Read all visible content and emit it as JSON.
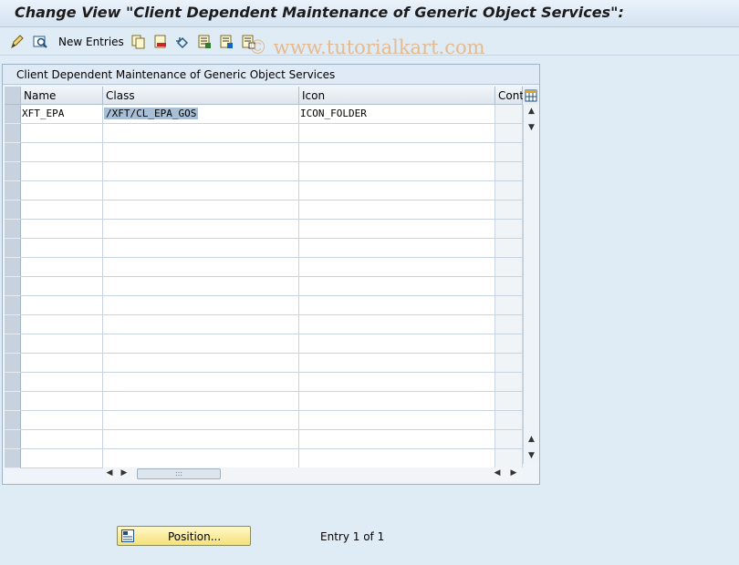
{
  "title": "Change View \"Client Dependent Maintenance of Generic Object Services\":",
  "toolbar": {
    "new_entries": "New Entries",
    "watermark": "© www.tutorialkart.com",
    "icons": [
      "display-change-icon",
      "details-icon",
      "new-entries",
      "copy-icon",
      "delete-icon",
      "undo-icon",
      "select-all-icon",
      "select-block-icon",
      "deselect-all-icon"
    ]
  },
  "panel": {
    "title": "Client Dependent Maintenance of Generic Object Services"
  },
  "table": {
    "columns": [
      "Name",
      "Class",
      "Icon",
      "Conti"
    ],
    "rows": [
      [
        "XFT_EPA",
        "/XFT/CL_EPA_GOS",
        "ICON_FOLDER",
        ""
      ]
    ],
    "empty_row_count": 18
  },
  "footer": {
    "position_label": "Position...",
    "entry_text": "Entry 1 of 1"
  },
  "colors": {
    "background": "#dfebf5",
    "selection_highlight": "#a9bfd6",
    "button_yellow": "#f5e17a"
  }
}
